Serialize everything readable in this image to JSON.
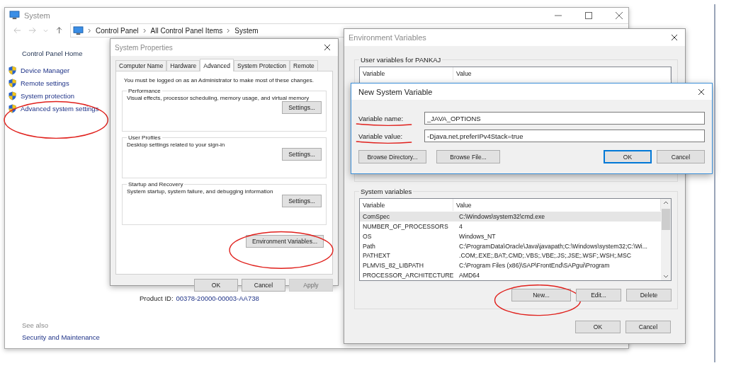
{
  "system_window": {
    "title": "System",
    "breadcrumb": [
      "Control Panel",
      "All Control Panel Items",
      "System"
    ],
    "sidebar": {
      "home": "Control Panel Home",
      "items": [
        {
          "label": "Device Manager",
          "annotated": false
        },
        {
          "label": "Remote settings",
          "annotated": false
        },
        {
          "label": "System protection",
          "annotated": false
        },
        {
          "label": "Advanced system settings",
          "annotated": true
        }
      ]
    },
    "product_id": {
      "label": "Product ID:",
      "value": "00378-20000-00003-AA738"
    },
    "see_also": {
      "heading": "See also",
      "links": [
        "Security and Maintenance"
      ]
    }
  },
  "system_properties": {
    "title": "System Properties",
    "tabs": [
      {
        "label": "Computer Name",
        "selected": false
      },
      {
        "label": "Hardware",
        "selected": false
      },
      {
        "label": "Advanced",
        "selected": true
      },
      {
        "label": "System Protection",
        "selected": false
      },
      {
        "label": "Remote",
        "selected": false
      }
    ],
    "notice": "You must be logged on as an Administrator to make most of these changes.",
    "groups": [
      {
        "title": "Performance",
        "description": "Visual effects, processor scheduling, memory usage, and virtual memory",
        "button": "Settings..."
      },
      {
        "title": "User Profiles",
        "description": "Desktop settings related to your sign-in",
        "button": "Settings..."
      },
      {
        "title": "Startup and Recovery",
        "description": "System startup, system failure, and debugging information",
        "button": "Settings..."
      }
    ],
    "env_button": {
      "label": "Environment Variables...",
      "annotated": true
    },
    "buttons": [
      {
        "label": "OK",
        "disabled": false
      },
      {
        "label": "Cancel",
        "disabled": false
      },
      {
        "label": "Apply",
        "disabled": true
      }
    ]
  },
  "environment_variables": {
    "title": "Environment Variables",
    "user_section": {
      "title": "User variables for PANKAJ",
      "columns": [
        "Variable",
        "Value"
      ]
    },
    "system_section": {
      "title": "System variables",
      "columns": [
        "Variable",
        "Value"
      ],
      "rows": [
        {
          "variable": "ComSpec",
          "value": "C:\\Windows\\system32\\cmd.exe",
          "selected": true
        },
        {
          "variable": "NUMBER_OF_PROCESSORS",
          "value": "4",
          "selected": false
        },
        {
          "variable": "OS",
          "value": "Windows_NT",
          "selected": false
        },
        {
          "variable": "Path",
          "value": "C:\\ProgramData\\Oracle\\Java\\javapath;C:\\Windows\\system32;C:\\Wi...",
          "selected": false
        },
        {
          "variable": "PATHEXT",
          "value": ".COM;.EXE;.BAT;.CMD;.VBS;.VBE;.JS;.JSE;.WSF;.WSH;.MSC",
          "selected": false
        },
        {
          "variable": "PLMVIS_82_LIBPATH",
          "value": "C:\\Program Files (x86)\\SAP\\FrontEnd\\SAPgui\\Program",
          "selected": false
        },
        {
          "variable": "PROCESSOR_ARCHITECTURE",
          "value": "AMD64",
          "selected": false
        }
      ],
      "buttons": [
        {
          "label": "New...",
          "annotated": true
        },
        {
          "label": "Edit...",
          "annotated": false
        },
        {
          "label": "Delete",
          "annotated": false
        }
      ]
    },
    "buttons": [
      "OK",
      "Cancel"
    ]
  },
  "new_system_variable": {
    "title": "New System Variable",
    "fields": [
      {
        "label": "Variable name:",
        "value": "_JAVA_OPTIONS",
        "annotated": true
      },
      {
        "label": "Variable value:",
        "value": "-Djava.net.preferIPv4Stack=true",
        "annotated": true
      }
    ],
    "buttons": [
      {
        "label": "Browse Directory...",
        "default": false
      },
      {
        "label": "Browse File...",
        "default": false
      },
      {
        "label": "OK",
        "default": true
      },
      {
        "label": "Cancel",
        "default": false
      }
    ]
  }
}
